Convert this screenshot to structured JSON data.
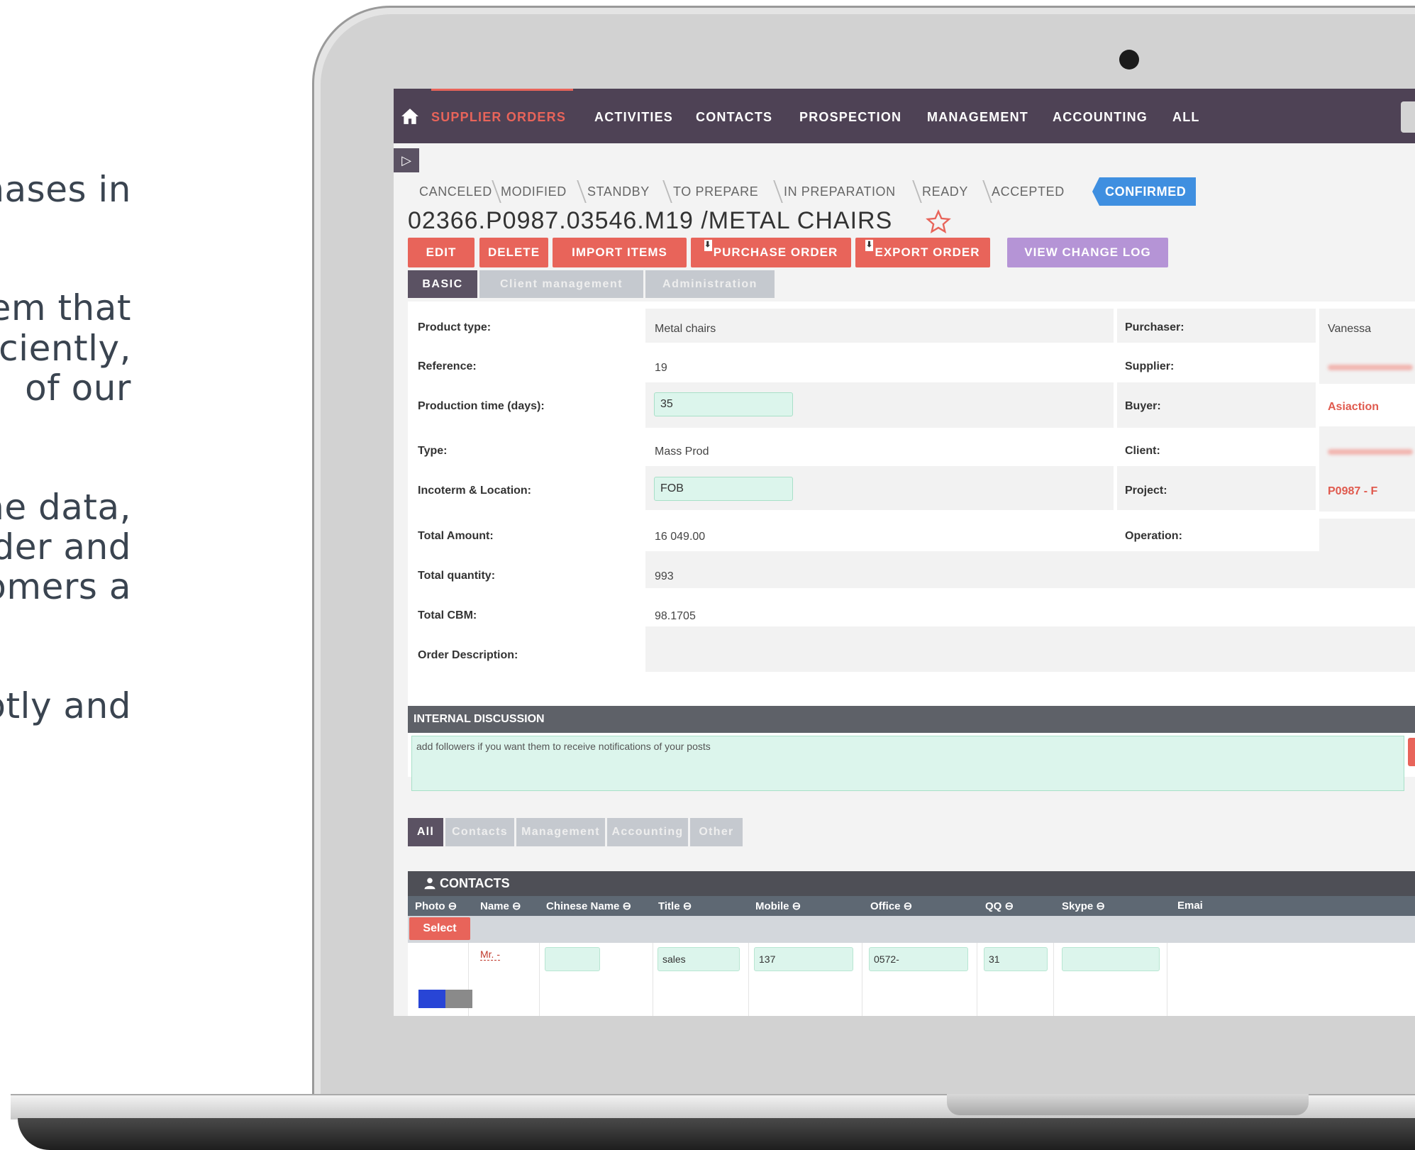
{
  "side_text": [
    "nases in",
    "em that",
    "ficiently,",
    "of our",
    "ne data,",
    "rder and",
    "omers a",
    "otly and"
  ],
  "nav": {
    "items": [
      {
        "label": "SUPPLIER ORDERS",
        "active": true
      },
      {
        "label": "ACTIVITIES",
        "active": false
      },
      {
        "label": "CONTACTS",
        "active": false
      },
      {
        "label": "PROSPECTION",
        "active": false
      },
      {
        "label": "MANAGEMENT",
        "active": false
      },
      {
        "label": "ACCOUNTING",
        "active": false
      },
      {
        "label": "ALL",
        "active": false
      }
    ],
    "home_icon": "home-icon"
  },
  "sidebar_toggle": "▷",
  "pipeline": {
    "stages": [
      "CANCELED",
      "MODIFIED",
      "STANDBY",
      "TO PREPARE",
      "IN PREPARATION",
      "READY",
      "ACCEPTED",
      "CONFIRMED"
    ],
    "current": "CONFIRMED"
  },
  "record": {
    "title": "02366.P0987.03546.M19 /METAL CHAIRS"
  },
  "actions": {
    "edit": "EDIT",
    "delete": "DELETE",
    "import_items": "IMPORT ITEMS",
    "purchase_order": "PURCHASE ORDER",
    "export_order": "EXPORT ORDER",
    "view_change_log": "VIEW CHANGE LOG"
  },
  "tabs": [
    "BASIC",
    "Client management",
    "Administration"
  ],
  "fields": {
    "product_type": {
      "label": "Product type:",
      "value": "Metal chairs"
    },
    "reference": {
      "label": "Reference:",
      "value": "19"
    },
    "production_time": {
      "label": "Production time (days):",
      "value": "35"
    },
    "type": {
      "label": "Type:",
      "value": "Mass Prod"
    },
    "incoterm": {
      "label": "Incoterm & Location:",
      "value": "FOB"
    },
    "total_amount": {
      "label": "Total Amount:",
      "value": "16 049.00"
    },
    "total_quantity": {
      "label": "Total quantity:",
      "value": "993"
    },
    "total_cbm": {
      "label": "Total CBM:",
      "value": "98.1705"
    },
    "order_description": {
      "label": "Order Description:",
      "value": ""
    },
    "purchaser": {
      "label": "Purchaser:",
      "value": "Vanessa"
    },
    "supplier": {
      "label": "Supplier:",
      "value": ""
    },
    "buyer": {
      "label": "Buyer:",
      "value": "Asiaction"
    },
    "client": {
      "label": "Client:",
      "value": ""
    },
    "project": {
      "label": "Project:",
      "value": "P0987 - F"
    },
    "operation": {
      "label": "Operation:",
      "value": ""
    }
  },
  "discussion": {
    "header": "INTERNAL DISCUSSION",
    "placeholder": "add followers if you want them to receive notifications of your posts"
  },
  "bottom_tabs": [
    "All",
    "Contacts",
    "Management",
    "Accounting",
    "Other"
  ],
  "contacts": {
    "header": "CONTACTS",
    "columns": [
      "Photo ⊖",
      "Name ⊖",
      "Chinese Name ⊖",
      "Title ⊖",
      "Mobile ⊖",
      "Office ⊖",
      "QQ ⊖",
      "Skype ⊖",
      "Emai"
    ],
    "select_label": "Select",
    "rows": [
      {
        "name": "Mr. -",
        "chinese_name": "",
        "title": "sales",
        "mobile": "137",
        "office": "0572-",
        "qq": "31",
        "skype": ""
      }
    ]
  },
  "colors": {
    "nav_bg": "#4e4255",
    "accent_red": "#e8645a",
    "accent_blue": "#3f8fe0",
    "accent_purple": "#b594d6",
    "input_green": "#dcf5ec"
  }
}
